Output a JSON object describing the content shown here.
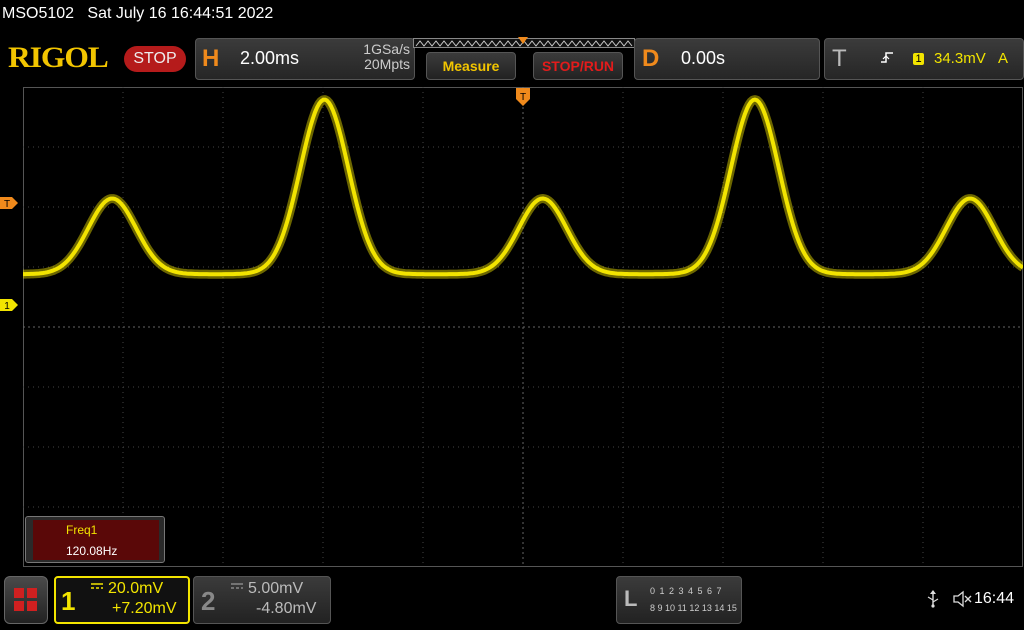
{
  "header": {
    "model": "MSO5102",
    "datetime": "Sat July 16 16:44:51 2022",
    "brand": "RIGOL",
    "run_state": "STOP"
  },
  "horizontal": {
    "letter": "H",
    "timebase": "2.00ms",
    "sample_rate": "1GSa/s",
    "memory_depth": "20Mpts"
  },
  "buttons": {
    "measure": "Measure",
    "stop_run": "STOP/RUN"
  },
  "delay": {
    "letter": "D",
    "value": "0.00s"
  },
  "trigger": {
    "letter": "T",
    "edge_icon": "rising-edge-icon",
    "source": "1",
    "level": "34.3mV",
    "coupling": "A"
  },
  "markers": {
    "trigger_level": "T",
    "ch1_ground": "1"
  },
  "measurement": {
    "name": "Freq1",
    "value": "120.08Hz"
  },
  "channels": [
    {
      "number": "1",
      "coupling_icon": "dc-coupling-icon",
      "scale": "20.0mV",
      "offset": "+7.20mV",
      "active": true,
      "color": "#f2e400"
    },
    {
      "number": "2",
      "coupling_icon": "dc-coupling-icon",
      "scale": "5.00mV",
      "offset": "-4.80mV",
      "active": false,
      "color": "#888888"
    }
  ],
  "logic": {
    "letter": "L",
    "row1": "0 1 2 3   4 5 6 7",
    "row2": "8 9 10 11  12 13 14 15"
  },
  "status": {
    "usb_icon": "usb-icon",
    "speaker_icon": "mute-icon",
    "time": "16:44"
  },
  "colors": {
    "trace": "#f2e400",
    "accent": "#f08a1c",
    "stop": "#b51b1b"
  },
  "waveform": {
    "peaks": [
      {
        "time_div": 1.45,
        "amplitude_div": 1.3
      },
      {
        "time_div": 4.9,
        "amplitude_div": 3.0
      },
      {
        "time_div": 8.45,
        "amplitude_div": 1.3
      },
      {
        "time_div": 11.9,
        "amplitude_div": 3.0
      },
      {
        "time_div": 15.4,
        "amplitude_div": 1.3
      }
    ],
    "baseline_div": 0.1
  }
}
